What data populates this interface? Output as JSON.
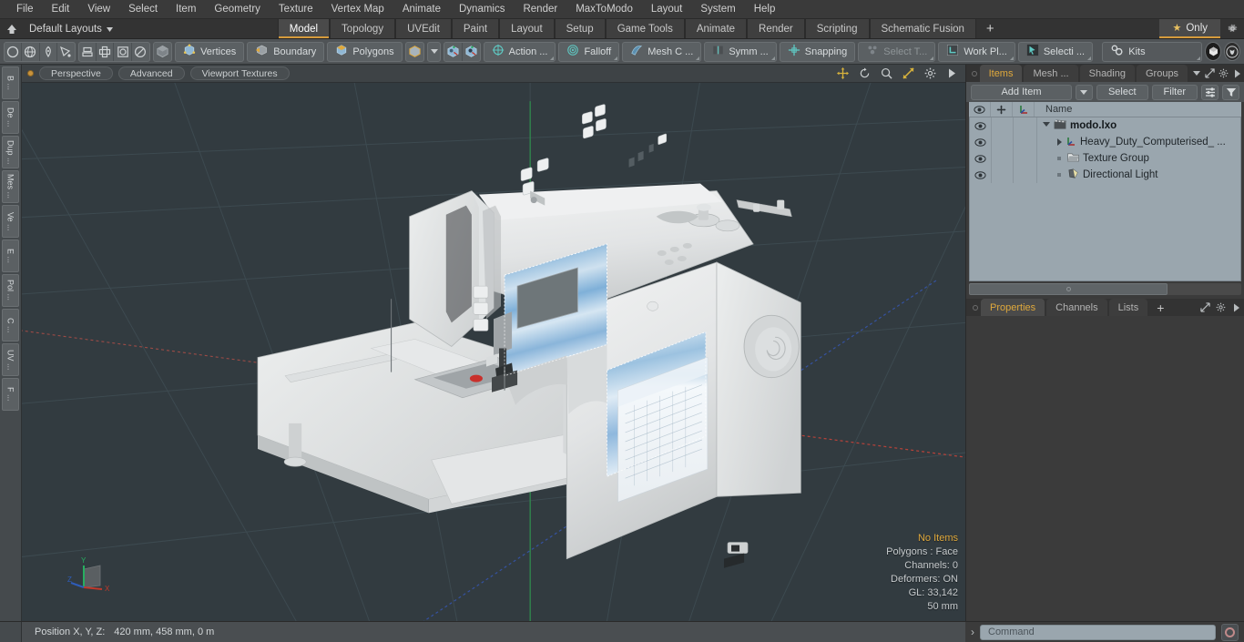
{
  "app": {
    "title": "modo"
  },
  "menubar": {
    "items": [
      "File",
      "Edit",
      "View",
      "Select",
      "Item",
      "Geometry",
      "Texture",
      "Vertex Map",
      "Animate",
      "Dynamics",
      "Render",
      "MaxToModo",
      "Layout",
      "System",
      "Help"
    ]
  },
  "layoutbar": {
    "home_icon": "home-icon",
    "layouts_label": "Default Layouts",
    "tabs": [
      {
        "label": "Model",
        "active": true
      },
      {
        "label": "Topology",
        "active": false
      },
      {
        "label": "UVEdit",
        "active": false
      },
      {
        "label": "Paint",
        "active": false
      },
      {
        "label": "Layout",
        "active": false
      },
      {
        "label": "Setup",
        "active": false
      },
      {
        "label": "Game Tools",
        "active": false
      },
      {
        "label": "Animate",
        "active": false
      },
      {
        "label": "Render",
        "active": false
      },
      {
        "label": "Scripting",
        "active": false
      },
      {
        "label": "Schematic Fusion",
        "active": false
      }
    ],
    "add_tab_label": "+",
    "only_label": "Only",
    "star_glyph": "★",
    "gear_icon": "gear-icon",
    "accent_color": "#d59b3c"
  },
  "toolbar": {
    "group_primitives": [
      "circle-icon",
      "globe-icon",
      "pen-icon",
      "curve-icon"
    ],
    "group_modes": [
      "align-icon",
      "center-icon",
      "frame-icon",
      "radial-icon"
    ],
    "mode_cube_icon": "cube-icon",
    "selection_modes": [
      {
        "label": "Vertices",
        "icon": "vertices-cube-icon"
      },
      {
        "label": "Boundary",
        "icon": "boundary-cube-icon"
      },
      {
        "label": "Polygons",
        "icon": "polygons-cube-icon"
      }
    ],
    "cube_dropdown_icon": "cube-icon",
    "snap_cubes": [
      "snap-cube-a-icon",
      "snap-cube-b-icon"
    ],
    "tools": [
      {
        "label": "Action  ...",
        "icon": "action-center-icon",
        "dim": false
      },
      {
        "label": "Falloff",
        "icon": "falloff-icon",
        "dim": false
      },
      {
        "label": "Mesh C ...",
        "icon": "mesh-constraint-icon",
        "dim": false
      },
      {
        "label": "Symm ...",
        "icon": "symmetry-icon",
        "dim": false
      },
      {
        "label": "Snapping",
        "icon": "snapping-icon",
        "dim": false
      },
      {
        "label": "Select T...",
        "icon": "select-through-icon",
        "dim": true
      },
      {
        "label": "Work Pl...",
        "icon": "work-plane-icon",
        "dim": false
      },
      {
        "label": "Selecti ...",
        "icon": "selection-set-icon",
        "dim": false
      },
      {
        "label": "Kits",
        "icon": "kits-gears-icon",
        "dim": false
      }
    ],
    "right_icons": [
      "modo-badge-icon",
      "unreal-badge-icon"
    ]
  },
  "vrail": {
    "tabs": [
      "B ...",
      "De ...",
      "Dup ...",
      "Mes ...",
      "Ve ...",
      "E ...",
      "Pol ...",
      "C ...",
      "UV ...",
      "F ..."
    ]
  },
  "viewport": {
    "header": {
      "indicator": "active-viewport-dot",
      "buttons": [
        "Perspective",
        "Advanced",
        "Viewport Textures"
      ],
      "icons": [
        "move-icon",
        "rotate-icon",
        "zoom-icon",
        "fit-icon",
        "gear-icon",
        "play-arrow-icon"
      ]
    },
    "background_color": "#323b40",
    "stats": {
      "selection": "No Items",
      "polygons": "Polygons : Face",
      "channels": "Channels: 0",
      "deformers": "Deformers: ON",
      "gl": "GL: 33,142",
      "grid": "50 mm"
    },
    "axis_gizmo": {
      "x_label": "X",
      "y_label": "Y",
      "z_label": "Z",
      "x_color": "#c0392b",
      "y_color": "#27ae60",
      "z_color": "#2e5cb8"
    },
    "model": {
      "name": "Heavy Duty Computerised Sewing Machine",
      "body_color": "#e8e9ea",
      "panel_color": "#8fb8dd"
    }
  },
  "right_panel": {
    "top_tabs": [
      {
        "label": "Items",
        "active": true
      },
      {
        "label": "Mesh ...",
        "active": false
      },
      {
        "label": "Shading",
        "active": false
      },
      {
        "label": "Groups",
        "active": false
      }
    ],
    "top_tab_icons": [
      "chevron-down-icon",
      "expand-icon",
      "gear-icon",
      "play-arrow-icon"
    ],
    "toolrow": {
      "add_item_label": "Add Item",
      "dropdown_icon": "chevron-down-icon",
      "select_label": "Select",
      "filter_label": "Filter",
      "list_icon": "list-options-icon",
      "funnel_icon": "funnel-icon"
    },
    "list_header": {
      "eye_icon": "eye-icon",
      "lock_icon": "move-lock-icon",
      "axis_icon": "axis-icon",
      "name_label": "Name"
    },
    "items": [
      {
        "label": "modo.lxo",
        "icon": "scene-icon",
        "depth": 0,
        "expanded": true,
        "root": true
      },
      {
        "label": "Heavy_Duty_Computerised_ ...",
        "icon": "mesh-axis-icon",
        "depth": 1,
        "expanded": false,
        "root": false
      },
      {
        "label": "Texture Group",
        "icon": "texture-group-icon",
        "depth": 1,
        "expanded": null,
        "root": false
      },
      {
        "label": "Directional Light",
        "icon": "directional-light-icon",
        "depth": 1,
        "expanded": null,
        "root": false
      }
    ],
    "bottom_tabs": [
      {
        "label": "Properties",
        "active": true
      },
      {
        "label": "Channels",
        "active": false
      },
      {
        "label": "Lists",
        "active": false
      }
    ],
    "bottom_add_label": "+",
    "bottom_tab_icons": [
      "expand-icon",
      "gear-icon",
      "play-arrow-icon"
    ]
  },
  "statusbar": {
    "position_label": "Position X, Y, Z:",
    "position_value": "420 mm, 458 mm, 0 m",
    "command_prompt": "›",
    "command_placeholder": "Command",
    "command_button_icon": "record-circle-icon"
  }
}
